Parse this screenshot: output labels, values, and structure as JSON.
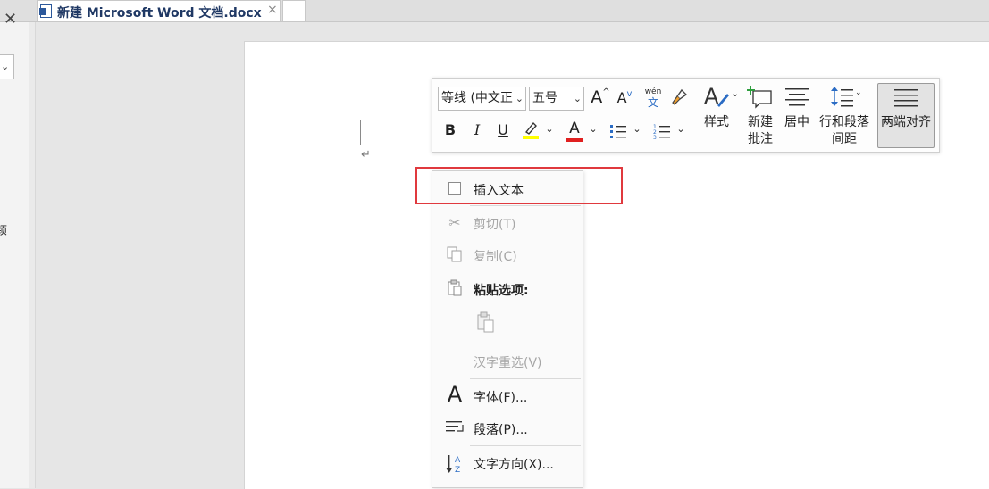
{
  "tab": {
    "title": "新建 Microsoft Word 文档.docx",
    "close": "×"
  },
  "left_pane": {
    "close": "✕",
    "dropdown_chev": "⌄",
    "partial_text": "题"
  },
  "page": {
    "paragraph_mark": "↵"
  },
  "mini_toolbar": {
    "font_name": "等线 (中文正",
    "font_size": "五号",
    "grow_font": "A",
    "shrink_font": "A",
    "phonetic_top": "wén",
    "phonetic_bottom": "文",
    "bold": "B",
    "italic": "I",
    "underline": "U",
    "font_color_letter": "A",
    "styles_label": "样式",
    "new_comment_line1": "新建",
    "new_comment_line2": "批注",
    "center_label": "居中",
    "line_spacing_line1": "行和段落",
    "line_spacing_line2": "间距",
    "justify_label": "两端对齐",
    "colors": {
      "highlight": "#ffff00",
      "font_color": "#e02020",
      "accent_blue": "#2b6cc4",
      "accent_green": "#2e9e3e"
    }
  },
  "context_menu": {
    "insert_text": "插入文本",
    "cut": "剪切(T)",
    "copy": "复制(C)",
    "paste_options": "粘贴选项:",
    "reconvert": "汉字重选(V)",
    "font": "字体(F)...",
    "paragraph": "段落(P)...",
    "text_direction": "文字方向(X)..."
  }
}
